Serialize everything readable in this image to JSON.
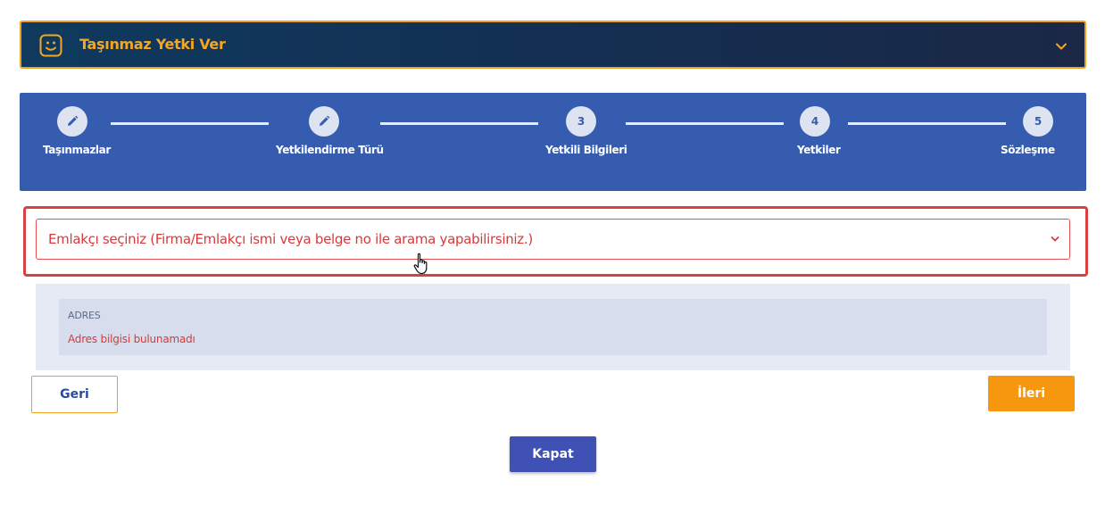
{
  "header": {
    "title": "Taşınmaz Yetki Ver",
    "icon": "smiley-icon",
    "toggle_icon": "chevron-down-icon",
    "accent_color": "#f5a623"
  },
  "stepper": {
    "background": "#355caf",
    "steps": [
      {
        "marker": "",
        "marker_icon": "pencil-icon",
        "label": "Taşınmazlar"
      },
      {
        "marker": "",
        "marker_icon": "pencil-icon",
        "label": "Yetkilendirme Türü"
      },
      {
        "marker": "3",
        "label": "Yetkili Bilgileri"
      },
      {
        "marker": "4",
        "label": "Yetkiler"
      },
      {
        "marker": "5",
        "label": "Sözleşme"
      }
    ]
  },
  "agent_select": {
    "placeholder": "Emlakçı seçiniz (Firma/Emlakçı ismi veya belge no ile arama yapabilirsiniz.)",
    "error_color": "#d83a3a"
  },
  "address": {
    "title": "ADRES",
    "value": "Adres bilgisi bulunamadı"
  },
  "buttons": {
    "back": "Geri",
    "next": "İleri",
    "close": "Kapat"
  }
}
